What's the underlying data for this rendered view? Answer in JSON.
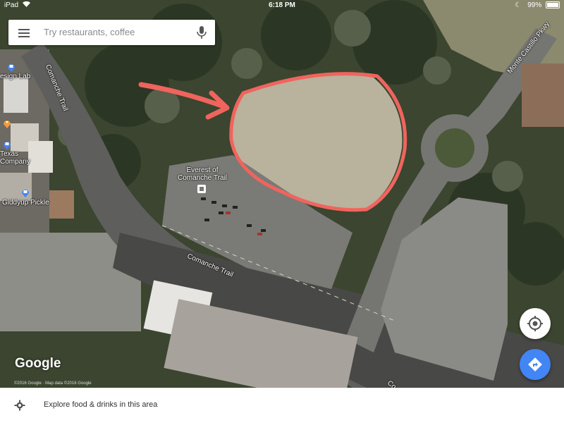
{
  "status_bar": {
    "device": "iPad",
    "time": "6:18 PM",
    "battery": "99%",
    "battery_level": 0.99
  },
  "search": {
    "placeholder": "Try restaurants, coffee",
    "menu_icon": "hamburger-menu-icon",
    "mic_icon": "microphone-icon"
  },
  "map": {
    "labels": {
      "design_lab": "esign Lab",
      "texas_company": "Texas\nCompany",
      "giddyup": "Giddyup Pickle",
      "everest": "Everest of\nComanche Trail",
      "comanche_trail_upper": "Comanche Trail",
      "comanche_trail_lower": "Comanche Trail",
      "monte_castillo": "Monte Castillo Pkwy",
      "co_edge": "Co"
    },
    "annotation_color": "#f0645e",
    "logo": "Google",
    "attribution": "©2016 Google · Map data ©2016 Google"
  },
  "controls": {
    "my_location_icon": "my-location-icon",
    "directions_icon": "directions-icon",
    "directions_color": "#4285f4"
  },
  "bottom_bar": {
    "icon": "gear-icon",
    "text": "Explore food & drinks in this area"
  }
}
